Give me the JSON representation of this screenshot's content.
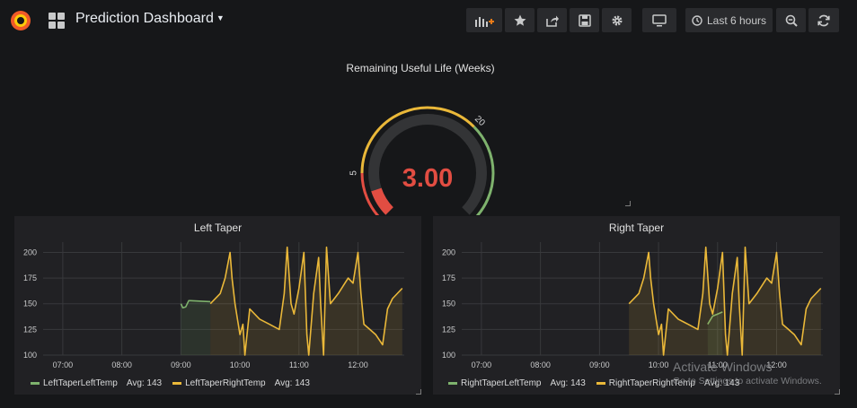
{
  "header": {
    "title": "Prediction Dashboard",
    "time_range_label": "Last 6 hours"
  },
  "colors": {
    "background": "#161719",
    "panel": "#212124",
    "series_green": "#7eb26d",
    "series_yellow": "#eab839",
    "gauge_red": "#e24d42"
  },
  "icons": [
    "grafana-logo-icon",
    "apps-grid-icon",
    "add-panel-icon",
    "star-icon",
    "share-icon",
    "save-icon",
    "gear-icon",
    "tv-mode-icon",
    "clock-icon",
    "zoom-out-icon",
    "refresh-icon"
  ],
  "gauge_panel": {
    "title": "Remaining Useful Life (Weeks)",
    "value": "3.00",
    "numeric_value": 3,
    "min": 0,
    "max": 30,
    "thresholds": [
      5,
      20
    ],
    "tick_labels": [
      "0",
      "5",
      "20",
      "30"
    ]
  },
  "left_panel": {
    "title": "Left Taper",
    "legend": [
      {
        "name": "LeftTaperLeftTemp",
        "avg": "Avg: 143"
      },
      {
        "name": "LeftTaperRightTemp",
        "avg": "Avg: 143"
      }
    ]
  },
  "right_panel": {
    "title": "Right Taper",
    "legend": [
      {
        "name": "RightTaperLeftTemp",
        "avg": "Avg: 143"
      },
      {
        "name": "RightTaperRightTemp",
        "avg": "Avg: 143"
      }
    ]
  },
  "chart_data": [
    {
      "type": "line",
      "title": "Left Taper",
      "x_ticks": [
        "07:00",
        "08:00",
        "09:00",
        "10:00",
        "11:00",
        "12:00"
      ],
      "y_ticks": [
        100,
        125,
        150,
        175,
        200
      ],
      "ylim": [
        100,
        210
      ],
      "xlim": [
        "06:40",
        "12:47"
      ],
      "grid": true,
      "legend_placement": "bottom-left",
      "series": [
        {
          "name": "LeftTaperLeftTemp",
          "color": "#7eb26d",
          "x": [
            "09:00",
            "09:02",
            "09:05",
            "09:08",
            "09:10",
            "09:30"
          ],
          "y": [
            150,
            146,
            147,
            153,
            153,
            152
          ]
        },
        {
          "name": "LeftTaperRightTemp",
          "color": "#eab839",
          "x": [
            "09:30",
            "09:40",
            "09:45",
            "09:50",
            "09:52",
            "09:55",
            "10:00",
            "10:03",
            "10:05",
            "10:10",
            "10:20",
            "10:30",
            "10:40",
            "10:45",
            "10:48",
            "10:52",
            "10:55",
            "11:00",
            "11:05",
            "11:08",
            "11:10",
            "11:15",
            "11:20",
            "11:22",
            "11:25",
            "11:28",
            "11:32",
            "11:40",
            "11:50",
            "11:55",
            "12:00",
            "12:03",
            "12:06",
            "12:12",
            "12:18",
            "12:25",
            "12:30",
            "12:35",
            "12:45"
          ],
          "y": [
            150,
            160,
            175,
            200,
            175,
            150,
            120,
            130,
            100,
            145,
            135,
            130,
            125,
            160,
            205,
            150,
            140,
            165,
            200,
            120,
            100,
            160,
            195,
            150,
            100,
            205,
            150,
            160,
            175,
            170,
            200,
            160,
            130,
            125,
            120,
            110,
            145,
            155,
            165
          ]
        }
      ]
    },
    {
      "type": "line",
      "title": "Right Taper",
      "x_ticks": [
        "07:00",
        "08:00",
        "09:00",
        "10:00",
        "11:00",
        "12:00"
      ],
      "y_ticks": [
        100,
        125,
        150,
        175,
        200
      ],
      "ylim": [
        100,
        210
      ],
      "xlim": [
        "06:40",
        "12:47"
      ],
      "grid": true,
      "legend_placement": "bottom-left",
      "series": [
        {
          "name": "RightTaperLeftTemp",
          "color": "#7eb26d",
          "x": [
            "10:50",
            "10:55",
            "11:00",
            "11:05"
          ],
          "y": [
            130,
            138,
            140,
            142
          ]
        },
        {
          "name": "RightTaperRightTemp",
          "color": "#eab839",
          "x": [
            "09:30",
            "09:40",
            "09:45",
            "09:50",
            "09:52",
            "09:55",
            "10:00",
            "10:03",
            "10:05",
            "10:10",
            "10:20",
            "10:30",
            "10:40",
            "10:45",
            "10:48",
            "10:52",
            "10:55",
            "11:00",
            "11:05",
            "11:08",
            "11:10",
            "11:15",
            "11:20",
            "11:22",
            "11:25",
            "11:28",
            "11:32",
            "11:40",
            "11:50",
            "11:55",
            "12:00",
            "12:03",
            "12:06",
            "12:12",
            "12:18",
            "12:25",
            "12:30",
            "12:35",
            "12:45"
          ],
          "y": [
            150,
            160,
            175,
            200,
            175,
            150,
            120,
            130,
            100,
            145,
            135,
            130,
            125,
            160,
            205,
            150,
            140,
            165,
            200,
            120,
            100,
            160,
            195,
            150,
            100,
            205,
            150,
            160,
            175,
            170,
            200,
            160,
            130,
            125,
            120,
            110,
            145,
            155,
            165
          ]
        }
      ]
    }
  ],
  "watermark": {
    "title": "Activate Windows",
    "subtitle": "Go to Settings to activate Windows."
  }
}
